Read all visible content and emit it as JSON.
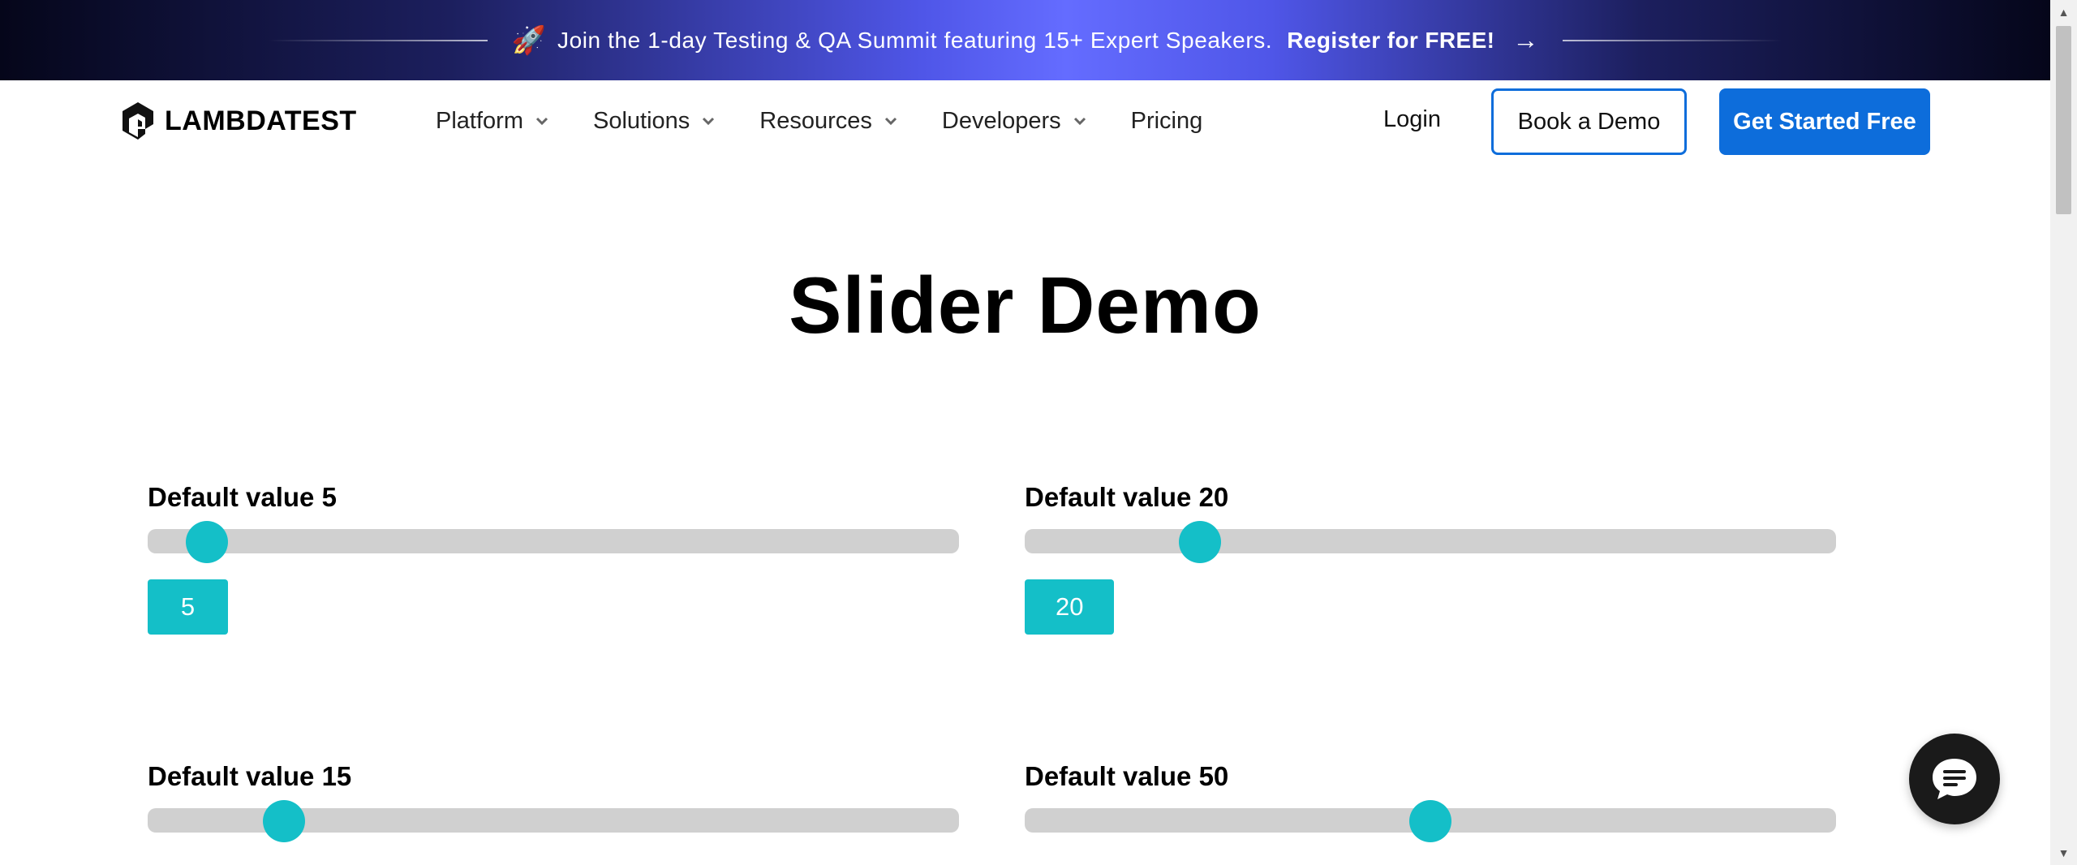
{
  "banner": {
    "rocket_icon": "🚀",
    "text": "Join the 1-day Testing & QA Summit featuring 15+ Expert Speakers.",
    "cta": "Register for FREE!",
    "arrow_icon": "→"
  },
  "header": {
    "logo_text": "LAMBDATEST",
    "nav": [
      {
        "label": "Platform",
        "has_dropdown": true
      },
      {
        "label": "Solutions",
        "has_dropdown": true
      },
      {
        "label": "Resources",
        "has_dropdown": true
      },
      {
        "label": "Developers",
        "has_dropdown": true
      },
      {
        "label": "Pricing",
        "has_dropdown": false
      }
    ],
    "login_label": "Login",
    "demo_label": "Book a Demo",
    "start_label": "Get Started Free"
  },
  "main": {
    "title": "Slider Demo",
    "sliders": [
      {
        "label": "Default value 5",
        "value": 5,
        "min": 0,
        "max": 100,
        "display": "5"
      },
      {
        "label": "Default value 20",
        "value": 20,
        "min": 0,
        "max": 100,
        "display": "20"
      },
      {
        "label": "Default value 15",
        "value": 15,
        "min": 0,
        "max": 100
      },
      {
        "label": "Default value 50",
        "value": 50,
        "min": 0,
        "max": 100
      }
    ]
  },
  "colors": {
    "accent": "#0d6ddb",
    "slider_thumb": "#14bfc8",
    "slider_track": "#d0d0d0"
  },
  "icons": {
    "chat": "chat-bubble-icon",
    "chevron": "chevron-down-icon"
  }
}
